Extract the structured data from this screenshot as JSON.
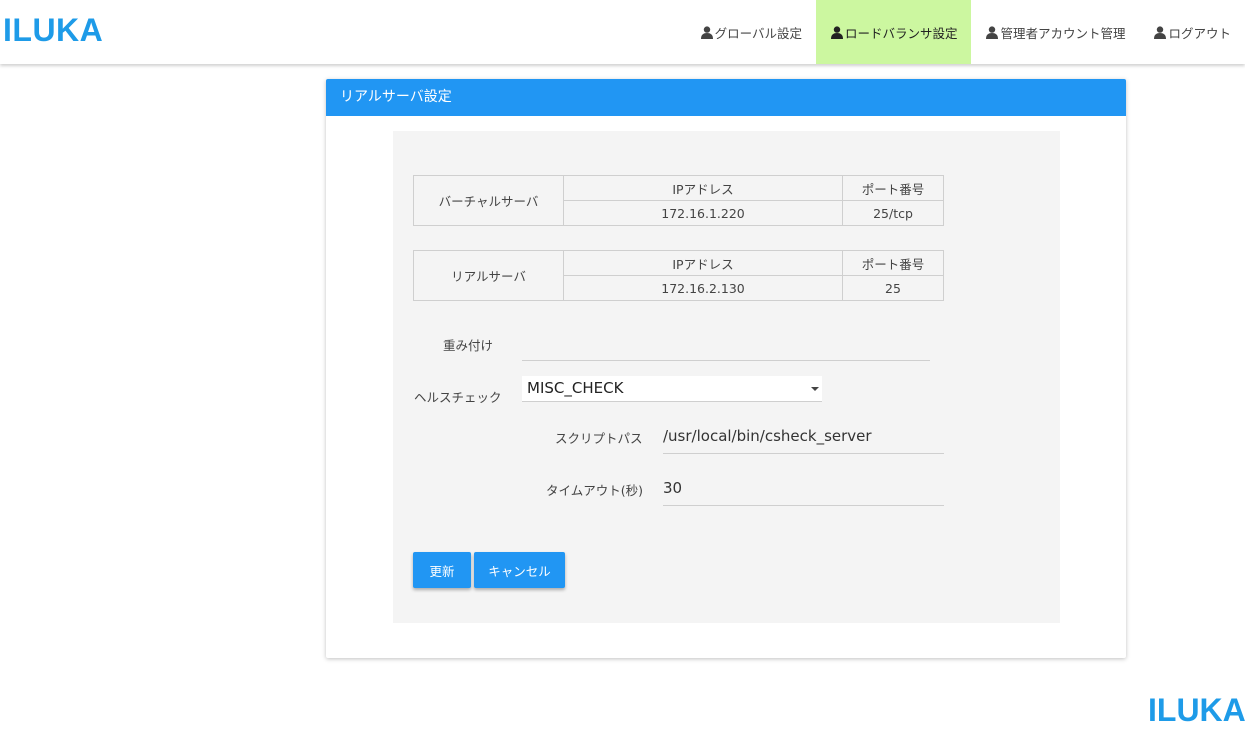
{
  "brand": "ILUKA",
  "nav": {
    "items": [
      {
        "label": "グローバル設定",
        "icon": "user-icon",
        "active": false
      },
      {
        "label": "ロードバランサ設定",
        "icon": "user-icon",
        "active": true
      },
      {
        "label": "管理者アカウント管理",
        "icon": "user-icon",
        "active": false
      },
      {
        "label": "ログアウト",
        "icon": "user-icon",
        "active": false
      }
    ],
    "active_color": "#ccf7a0"
  },
  "card": {
    "title": "リアルサーバ設定",
    "header_color": "#2196f3"
  },
  "virtual_server": {
    "row_header": "バーチャルサーバ",
    "ip_header": "IPアドレス",
    "port_header": "ポート番号",
    "ip": "172.16.1.220",
    "port": "25/tcp"
  },
  "real_server": {
    "row_header": "リアルサーバ",
    "ip_header": "IPアドレス",
    "port_header": "ポート番号",
    "ip": "172.16.2.130",
    "port": "25"
  },
  "form": {
    "weight_label": "重み付け",
    "weight_value": "",
    "healthcheck_label": "ヘルスチェック",
    "healthcheck_value": "MISC_CHECK",
    "script_path_label": "スクリプトパス",
    "script_path_value": "/usr/local/bin/csheck_server",
    "timeout_label": "タイムアウト(秒)",
    "timeout_value": "30"
  },
  "buttons": {
    "update": "更新",
    "cancel": "キャンセル"
  },
  "footer_brand": "ILUKA"
}
